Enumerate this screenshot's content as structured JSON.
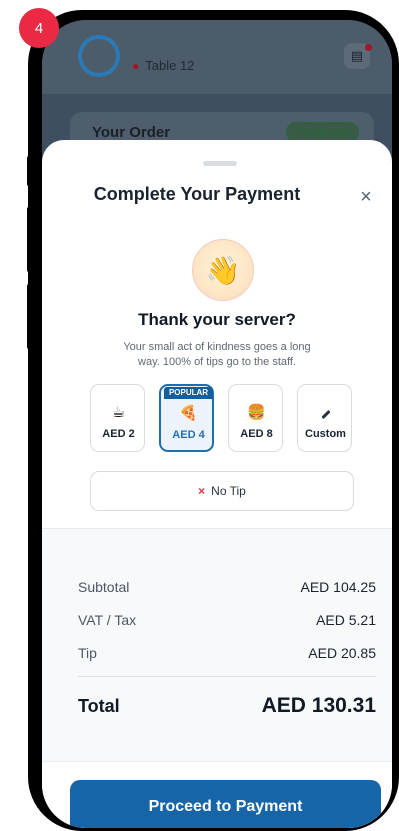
{
  "step": {
    "number": "4"
  },
  "background_app": {
    "table_label": "Table 12",
    "order_title": "Your Order",
    "order_status": "Confirmed"
  },
  "payment_sheet": {
    "title": "Complete Your Payment",
    "close_symbol": "×",
    "thank_title": "Thank your server?",
    "thank_subtitle": "Your small act of kindness goes a long way. 100% of tips go to the staff.",
    "tip_options": [
      {
        "label": "AED 2",
        "emoji": "☕",
        "selected": false
      },
      {
        "label": "AED 4",
        "emoji": "🍕",
        "selected": true,
        "badge": "POPULAR"
      },
      {
        "label": "AED 8",
        "emoji": "🍔",
        "selected": false
      },
      {
        "label": "Custom",
        "icon": "pencil-icon",
        "selected": false
      }
    ],
    "no_tip_symbol": "×",
    "no_tip_label": "No Tip",
    "summary": {
      "subtotal_label": "Subtotal",
      "subtotal_value": "AED 104.25",
      "vat_label": "VAT / Tax",
      "vat_value": "AED 5.21",
      "tip_label": "Tip",
      "tip_value": "AED 20.85",
      "total_label": "Total",
      "total_value": "AED 130.31"
    },
    "proceed_label": "Proceed to Payment"
  },
  "colors": {
    "accent": "#1665a8",
    "selected_tip": "#1f6fb0",
    "badge": "#ea2a44",
    "no_tip_x": "#e5304b"
  }
}
